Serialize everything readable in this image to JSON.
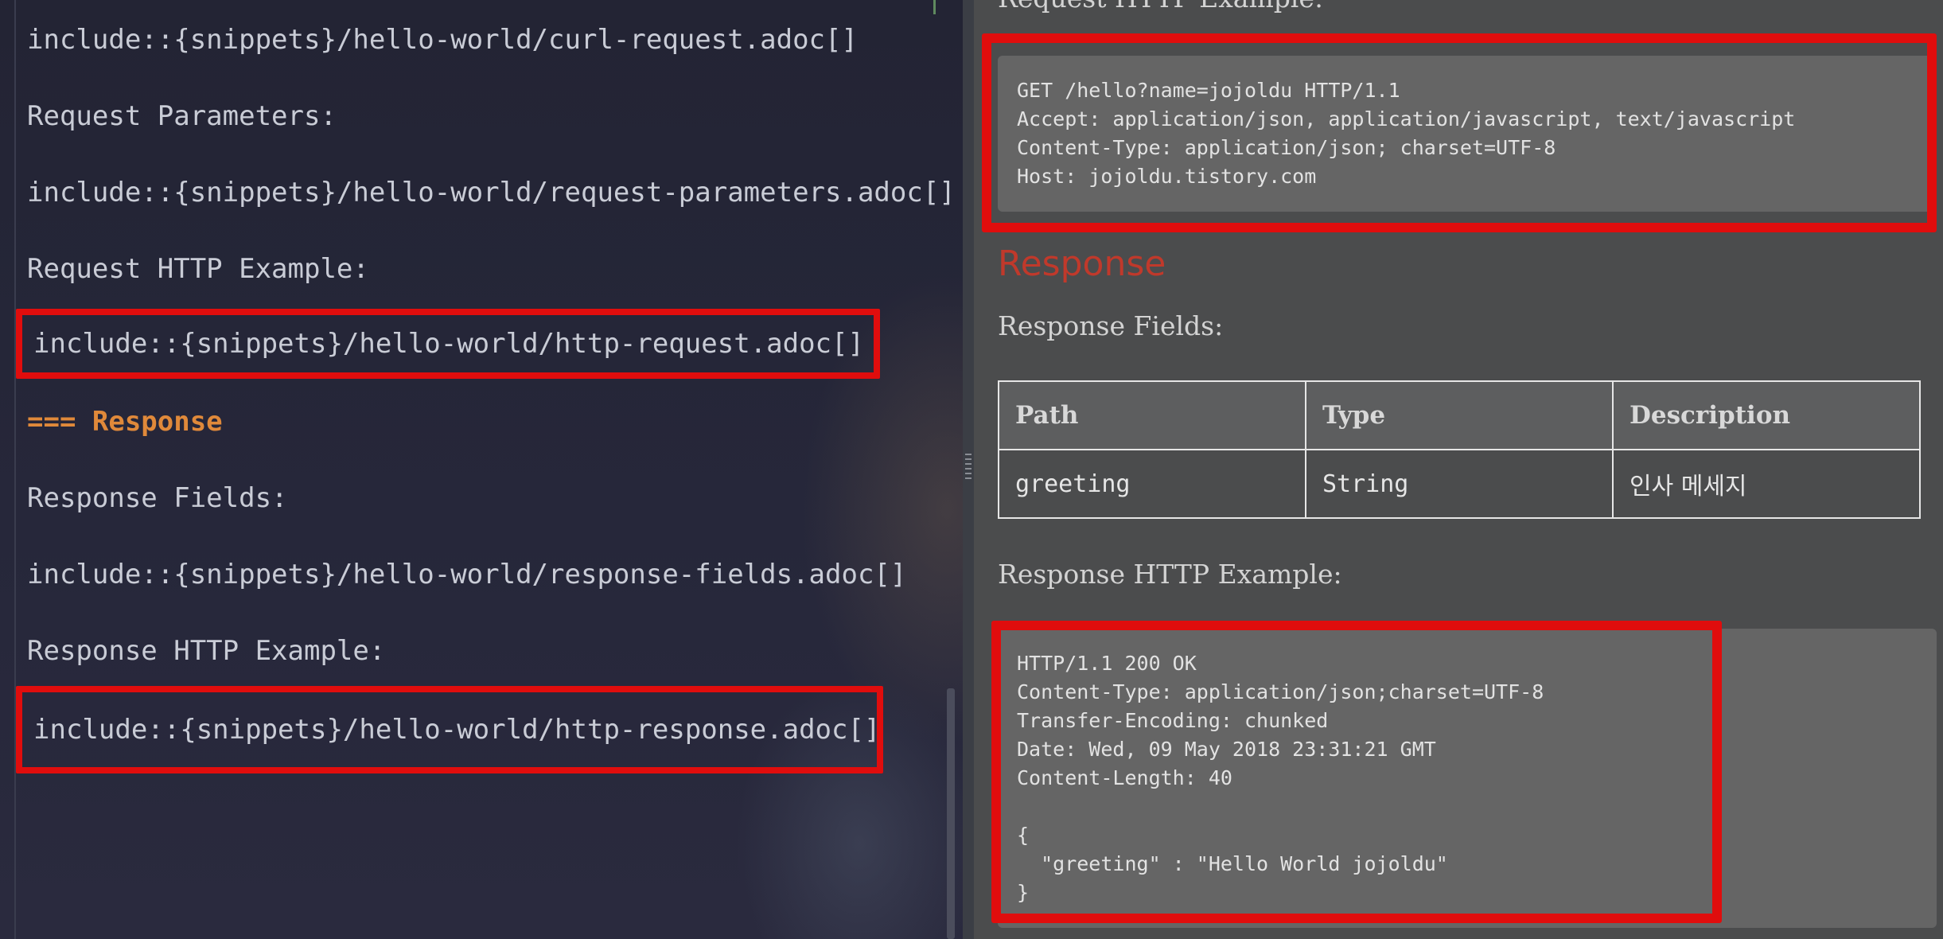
{
  "editor": {
    "lines": [
      "include::{snippets}/hello-world/curl-request.adoc[]",
      "Request Parameters:",
      "include::{snippets}/hello-world/request-parameters.adoc[]",
      "Request HTTP Example:",
      "include::{snippets}/hello-world/http-request.adoc[]",
      "=== Response",
      "Response Fields:",
      "include::{snippets}/hello-world/response-fields.adoc[]",
      "Response HTTP Example:",
      "include::{snippets}/hello-world/http-response.adoc[]"
    ]
  },
  "preview": {
    "request_example_label": "Request HTTP Example:",
    "request_listing": [
      "GET /hello?name=jojoldu HTTP/1.1",
      "Accept: application/json, application/javascript, text/javascript",
      "Content-Type: application/json; charset=UTF-8",
      "Host: jojoldu.tistory.com"
    ],
    "response_title": "Response",
    "response_fields_label": "Response Fields:",
    "table": {
      "headers": [
        "Path",
        "Type",
        "Description"
      ],
      "rows": [
        [
          "greeting",
          "String",
          "인사 메세지"
        ]
      ]
    },
    "response_example_label": "Response HTTP Example:",
    "response_listing": [
      "HTTP/1.1 200 OK",
      "Content-Type: application/json;charset=UTF-8",
      "Transfer-Encoding: chunked",
      "Date: Wed, 09 May 2018 23:31:21 GMT",
      "Content-Length: 40",
      "",
      "{",
      "  \"greeting\" : \"Hello World jojoldu\"",
      "}"
    ]
  },
  "colors": {
    "highlight_red": "#e00d0d",
    "heading_orange": "#e0893a",
    "response_title_red": "#c0392b"
  }
}
